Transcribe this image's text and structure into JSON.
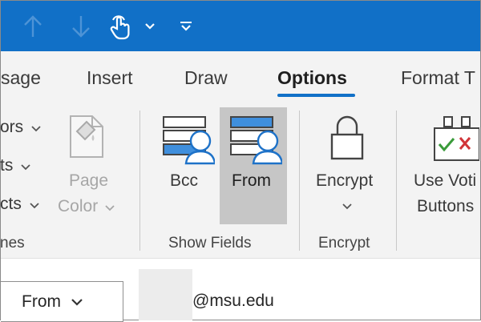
{
  "qat": {
    "icons": [
      "up-arrow-icon",
      "down-arrow-icon",
      "touch-mode-icon",
      "chevron-down-icon",
      "customize-qat-icon"
    ],
    "brand_color": "#1170c7"
  },
  "tabs": [
    {
      "label": "sage",
      "active": false
    },
    {
      "label": "Insert",
      "active": false
    },
    {
      "label": "Draw",
      "active": false
    },
    {
      "label": "Options",
      "active": true
    },
    {
      "label": "Format T",
      "active": false
    }
  ],
  "ribbon": {
    "partial_items": [
      "ors",
      "ts",
      "cts"
    ],
    "partial_group_label": "nes",
    "page_color": {
      "line1": "Page",
      "line2": "Color"
    },
    "bcc_label": "Bcc",
    "from_label": "From",
    "show_fields_label": "Show Fields",
    "encrypt_button": "Encrypt",
    "encrypt_group_label": "Encrypt",
    "voting": {
      "line1": "Use Voti",
      "line2": "Buttons"
    }
  },
  "compose": {
    "from_button": "From",
    "email_suffix": "@msu.edu"
  }
}
